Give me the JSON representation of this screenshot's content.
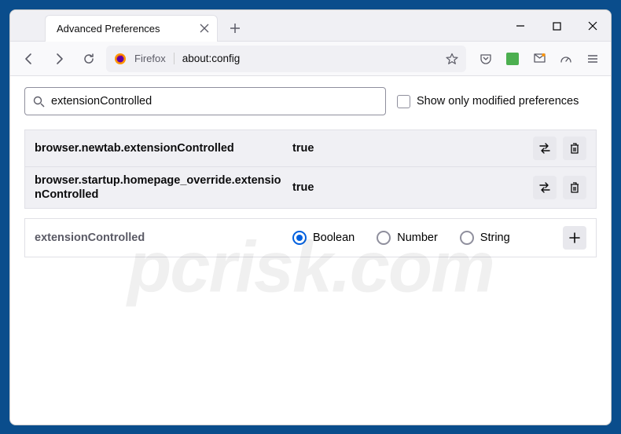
{
  "window": {
    "tab_title": "Advanced Preferences"
  },
  "toolbar": {
    "identity_label": "Firefox",
    "url": "about:config"
  },
  "search": {
    "value": "extensionControlled",
    "filter_label": "Show only modified preferences"
  },
  "prefs": [
    {
      "name": "browser.newtab.extensionControlled",
      "value": "true"
    },
    {
      "name": "browser.startup.homepage_override.extensionControlled",
      "value": "true"
    }
  ],
  "add": {
    "newname": "extensionControlled",
    "opt_boolean": "Boolean",
    "opt_number": "Number",
    "opt_string": "String"
  },
  "watermark": "pcrisk.com"
}
